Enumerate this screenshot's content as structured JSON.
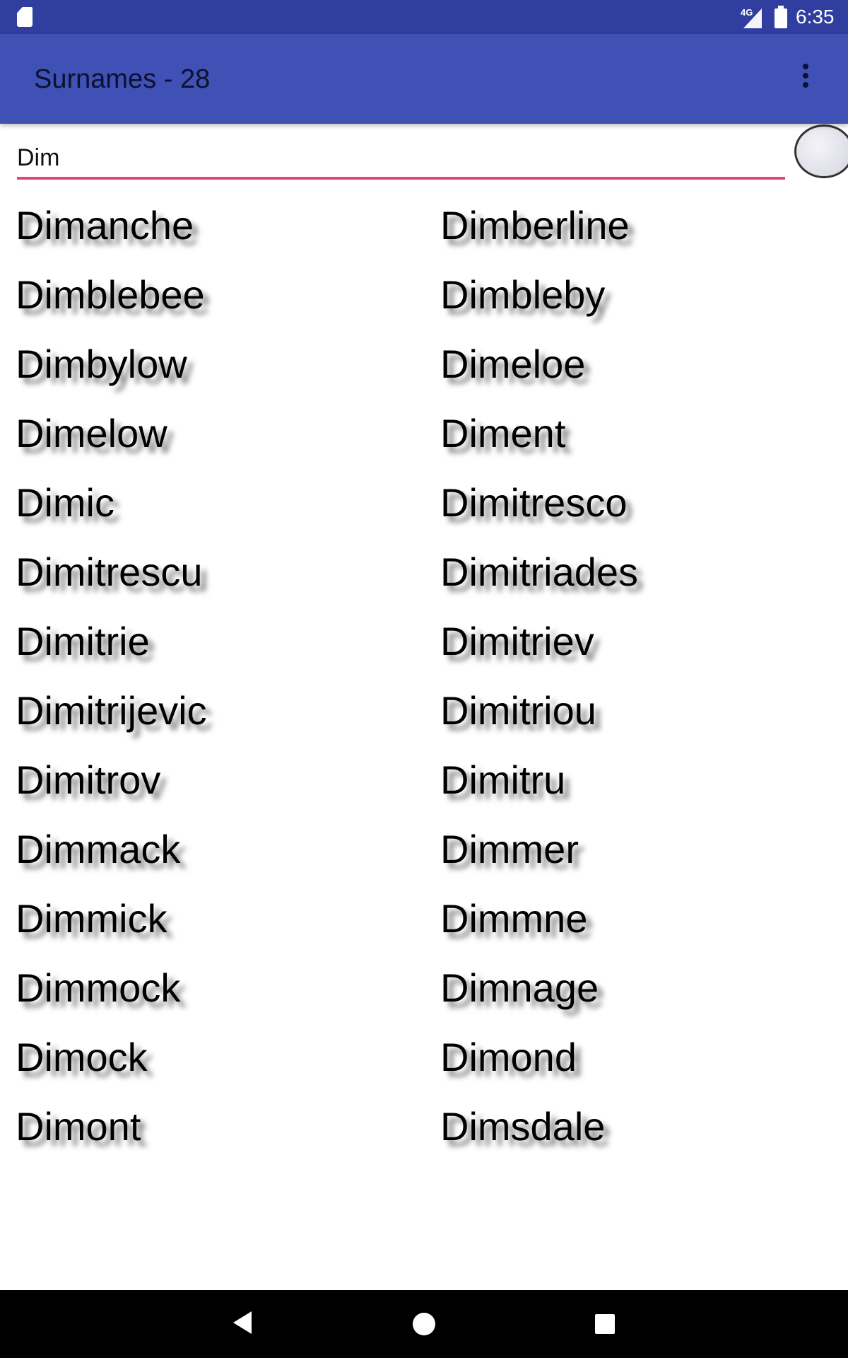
{
  "status_bar": {
    "time": "6:35",
    "network": "4G",
    "icons": [
      "sd-card-icon",
      "signal-icon",
      "battery-charging-icon"
    ]
  },
  "app_bar": {
    "title": "Surnames - 28",
    "menu_icon": "more-vert-icon"
  },
  "search": {
    "value": "Dim"
  },
  "colors": {
    "primary": "#3f51b5",
    "primary_dark": "#303f9f",
    "accent": "#e2457a"
  },
  "names": [
    "Dimanche",
    "Dimberline",
    "Dimblebee",
    "Dimbleby",
    "Dimbylow",
    "Dimeloe",
    "Dimelow",
    "Diment",
    "Dimic",
    "Dimitresco",
    "Dimitrescu",
    "Dimitriades",
    "Dimitrie",
    "Dimitriev",
    "Dimitrijevic",
    "Dimitriou",
    "Dimitrov",
    "Dimitru",
    "Dimmack",
    "Dimmer",
    "Dimmick",
    "Dimmne",
    "Dimmock",
    "Dimnage",
    "Dimock",
    "Dimond",
    "Dimont",
    "Dimsdale"
  ],
  "nav_bar": {
    "icons": [
      "back-icon",
      "home-icon",
      "recents-icon"
    ]
  }
}
